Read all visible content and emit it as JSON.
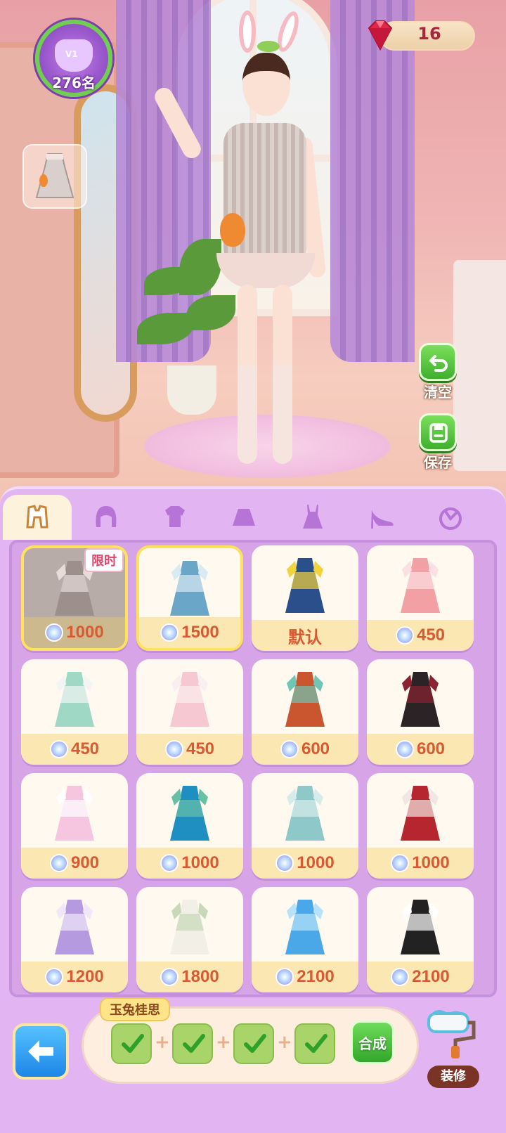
{
  "hud": {
    "rank_text": "276名",
    "gem_count": "16"
  },
  "side_actions": {
    "clear_label": "清空",
    "save_label": "保存"
  },
  "tabs": [
    {
      "icon": "full-outfit-icon",
      "active": true
    },
    {
      "icon": "hair-icon",
      "active": false
    },
    {
      "icon": "top-icon",
      "active": false
    },
    {
      "icon": "skirt-icon",
      "active": false
    },
    {
      "icon": "dress-icon",
      "active": false
    },
    {
      "icon": "shoes-icon",
      "active": false
    },
    {
      "icon": "accessory-icon",
      "active": false
    }
  ],
  "outfits": [
    {
      "price": "1000",
      "badge": "限时",
      "state": "selected",
      "colors": [
        "#9c8f8c",
        "#e7dcd8"
      ]
    },
    {
      "price": "1500",
      "state": "highlight",
      "colors": [
        "#6aa6c8",
        "#d8eaf2"
      ]
    },
    {
      "price": "默认",
      "colors": [
        "#2a4f8a",
        "#f4d23a"
      ]
    },
    {
      "price": "450",
      "colors": [
        "#f3a0a4",
        "#fbdfe2"
      ]
    },
    {
      "price": "450",
      "colors": [
        "#9fd8c4",
        "#f2f5f3"
      ]
    },
    {
      "price": "450",
      "colors": [
        "#f6c8d2",
        "#fbeef0"
      ]
    },
    {
      "price": "600",
      "colors": [
        "#c9562e",
        "#6fc6b4"
      ]
    },
    {
      "price": "600",
      "colors": [
        "#2c2326",
        "#8a2230"
      ]
    },
    {
      "price": "900",
      "colors": [
        "#f6c6e0",
        "#ffffff"
      ]
    },
    {
      "price": "1000",
      "colors": [
        "#1f8fc2",
        "#68c0a4"
      ]
    },
    {
      "price": "1000",
      "colors": [
        "#8fc8c8",
        "#d6ecea"
      ]
    },
    {
      "price": "1000",
      "colors": [
        "#b5262e",
        "#f2e6e2"
      ]
    },
    {
      "price": "1200",
      "colors": [
        "#b69ae0",
        "#f0e8f8"
      ]
    },
    {
      "price": "1800",
      "colors": [
        "#f2f0e6",
        "#c8d8b8"
      ]
    },
    {
      "price": "2100",
      "colors": [
        "#4aa8e8",
        "#b8e2fa"
      ]
    },
    {
      "price": "2100",
      "colors": [
        "#222222",
        "#ffffff"
      ]
    }
  ],
  "combo": {
    "title": "玉兔桂思",
    "merge_label": "合成",
    "item_count": 4
  },
  "decorate_label": "装修",
  "colors": {
    "panel": "#e3b4f2",
    "card_price_bg": "#fbe7b2",
    "price_text": "#d85a32",
    "selected_border": "#ffe25c",
    "green_button": "#3fb02e"
  }
}
